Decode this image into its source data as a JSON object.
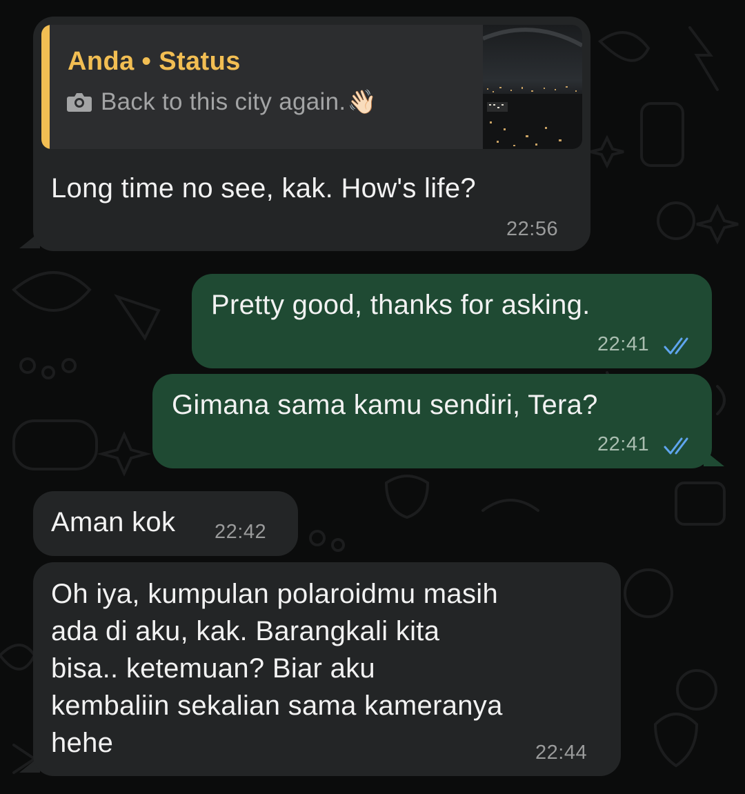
{
  "messages": [
    {
      "id": "m1",
      "direction": "incoming",
      "quote": {
        "title": "Anda • Status",
        "body": "Back to this city again.",
        "icon": "camera-icon",
        "emoji": "👋🏻"
      },
      "text": "Long time no see, kak. How's life?",
      "time": "22:56"
    },
    {
      "id": "m2",
      "direction": "outgoing",
      "text": "Pretty good, thanks for asking.",
      "time": "22:41",
      "status": "read"
    },
    {
      "id": "m3",
      "direction": "outgoing",
      "text": "Gimana sama kamu sendiri, Tera?",
      "time": "22:41",
      "status": "read"
    },
    {
      "id": "m4",
      "direction": "incoming",
      "text": "Aman kok",
      "time": "22:42"
    },
    {
      "id": "m5",
      "direction": "incoming",
      "lines": [
        "Oh iya, kumpulan polaroidmu masih",
        "ada di aku, kak. Barangkali kita",
        "bisa.. ketemuan? Biar aku",
        "kembaliin sekalian sama kameranya",
        "hehe"
      ],
      "time": "22:44"
    }
  ],
  "colors": {
    "background": "#0b0c0c",
    "incoming_bubble": "#232526",
    "outgoing_bubble": "#1f4a33",
    "quote_accent": "#f2be53",
    "read_ticks": "#5fa5ee"
  }
}
